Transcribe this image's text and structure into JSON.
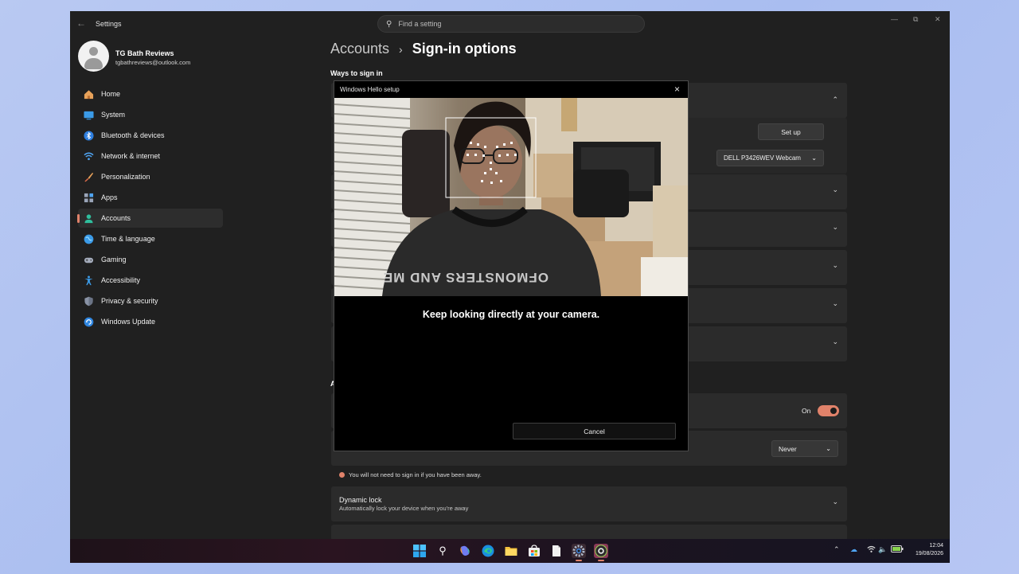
{
  "window": {
    "app_title": "Settings",
    "back_icon": "back-arrow-icon",
    "search_placeholder": "Find a setting",
    "controls": [
      "minimize",
      "maximize",
      "close"
    ]
  },
  "profile": {
    "name": "TG Bath Reviews",
    "email": "tgbathreviews@outlook.com"
  },
  "nav": {
    "items": [
      {
        "label": "Home",
        "icon": "home-icon"
      },
      {
        "label": "System",
        "icon": "system-icon"
      },
      {
        "label": "Bluetooth & devices",
        "icon": "bluetooth-icon"
      },
      {
        "label": "Network & internet",
        "icon": "wifi-icon"
      },
      {
        "label": "Personalization",
        "icon": "brush-icon"
      },
      {
        "label": "Apps",
        "icon": "apps-icon"
      },
      {
        "label": "Accounts",
        "icon": "accounts-icon",
        "active": true
      },
      {
        "label": "Time & language",
        "icon": "globe-icon"
      },
      {
        "label": "Gaming",
        "icon": "gamepad-icon"
      },
      {
        "label": "Accessibility",
        "icon": "accessibility-icon"
      },
      {
        "label": "Privacy & security",
        "icon": "shield-icon"
      },
      {
        "label": "Windows Update",
        "icon": "update-icon"
      }
    ]
  },
  "main": {
    "breadcrumb_parent": "Accounts",
    "breadcrumb_current": "Sign-in options",
    "section_ways": "Ways to sign in",
    "section_additional_partial": "A",
    "setup_button": "Set up",
    "camera_select": "DELL P3426WEV Webcam",
    "toggle_label": "On",
    "toggle_state": true,
    "never_select": "Never",
    "away_note": "You will not need to sign in if you have been away.",
    "dynamic_lock_title": "Dynamic lock",
    "dynamic_lock_sub": "Automatically lock your device when you're away",
    "accent_color": "#e0826a"
  },
  "dialog": {
    "title": "Windows Hello setup",
    "message": "Keep looking directly at your camera.",
    "cancel": "Cancel",
    "sweatshirt_text": "OFMONSTERS AND ME"
  },
  "taskbar": {
    "time": "12:04",
    "date": "19/08/2026",
    "apps": [
      "start-icon",
      "search-icon",
      "copilot-icon",
      "edge-icon",
      "file-explorer-icon",
      "store-icon",
      "notepad-icon",
      "settings-icon",
      "camera-app-icon"
    ]
  }
}
